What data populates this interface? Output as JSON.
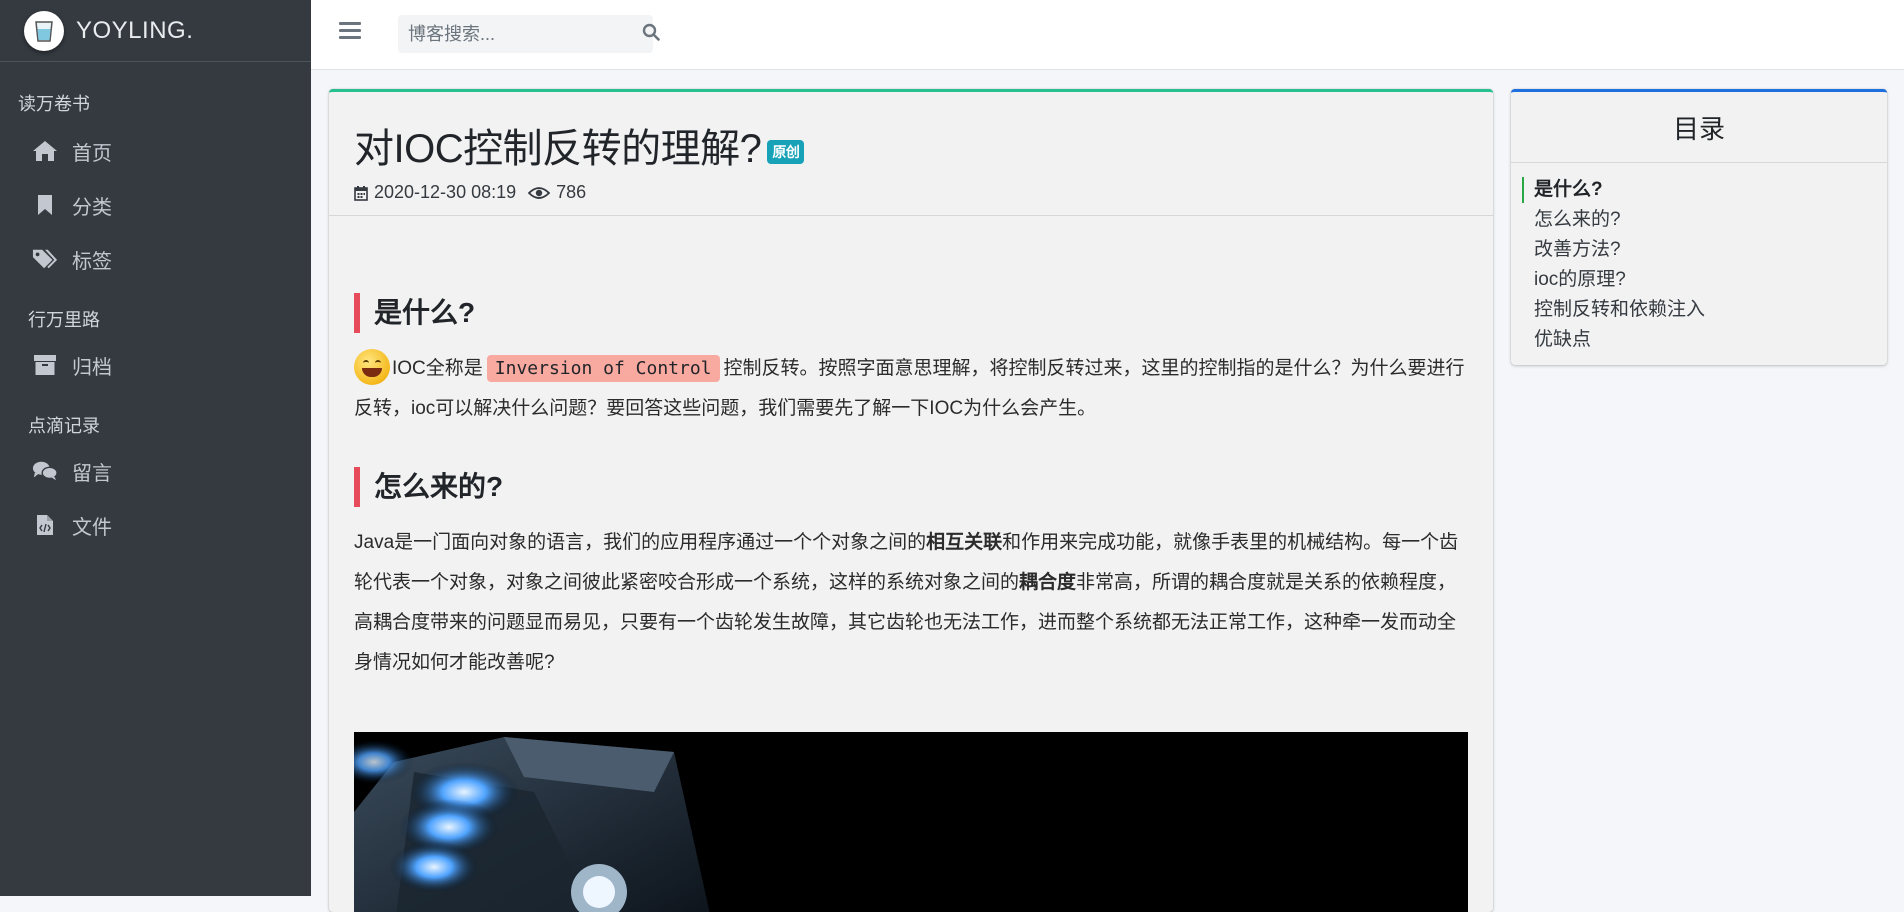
{
  "brand": {
    "name": "YOYLING."
  },
  "sidebar": {
    "sections": [
      {
        "header": "读万卷书",
        "items": [
          {
            "label": "首页",
            "icon": "home-icon"
          },
          {
            "label": "分类",
            "icon": "bookmark-icon"
          },
          {
            "label": "标签",
            "icon": "tags-icon"
          }
        ]
      },
      {
        "header": "行万里路",
        "items": [
          {
            "label": "归档",
            "icon": "archive-icon"
          }
        ]
      },
      {
        "header": "点滴记录",
        "items": [
          {
            "label": "留言",
            "icon": "comments-icon"
          },
          {
            "label": "文件",
            "icon": "file-code-icon"
          }
        ]
      }
    ]
  },
  "search": {
    "placeholder": "博客搜索..."
  },
  "post": {
    "title": "对IOC控制反转的理解?",
    "badge": "原创",
    "date": "2020-12-30 08:19",
    "views": "786",
    "sections": [
      {
        "heading": "是什么?",
        "p_before": "IOC全称是",
        "code": "Inversion of Control",
        "p_after": "控制反转。按照字面意思理解，将控制反转过来，这里的控制指的是什么？为什么要进行反转，ioc可以解决什么问题？要回答这些问题，我们需要先了解一下IOC为什么会产生。"
      },
      {
        "heading": "怎么来的?",
        "p1": "Java是一门面向对象的语言，我们的应用程序通过一个个对象之间的",
        "b1": "相互关联",
        "p2": "和作用来完成功能，就像手表里的机械结构。每一个齿轮代表一个对象，对象之间彼此紧密咬合形成一个系统，这样的系统对象之间的",
        "b2": "耦合度",
        "p3": "非常高，所谓的耦合度就是关系的依赖程度，高耦合度带来的问题显而易见，只要有一个齿轮发生故障，其它齿轮也无法工作，进而整个系统都无法正常工作，这种牵一发而动全身情况如何才能改善呢?"
      }
    ]
  },
  "toc": {
    "title": "目录",
    "items": [
      "是什么?",
      "怎么来的?",
      "改善方法?",
      "ioc的原理?",
      "控制反转和依赖注入",
      "优缺点"
    ],
    "active_index": 0
  },
  "colors": {
    "sidebar_bg": "#343a40",
    "card_top_border": "#28c08e",
    "toc_top_border": "#1f6fe0",
    "heading_bar": "#e64a5b",
    "badge_bg": "#17a2b8",
    "code_bg": "#f8a9a0",
    "toc_active": "#28a745"
  }
}
